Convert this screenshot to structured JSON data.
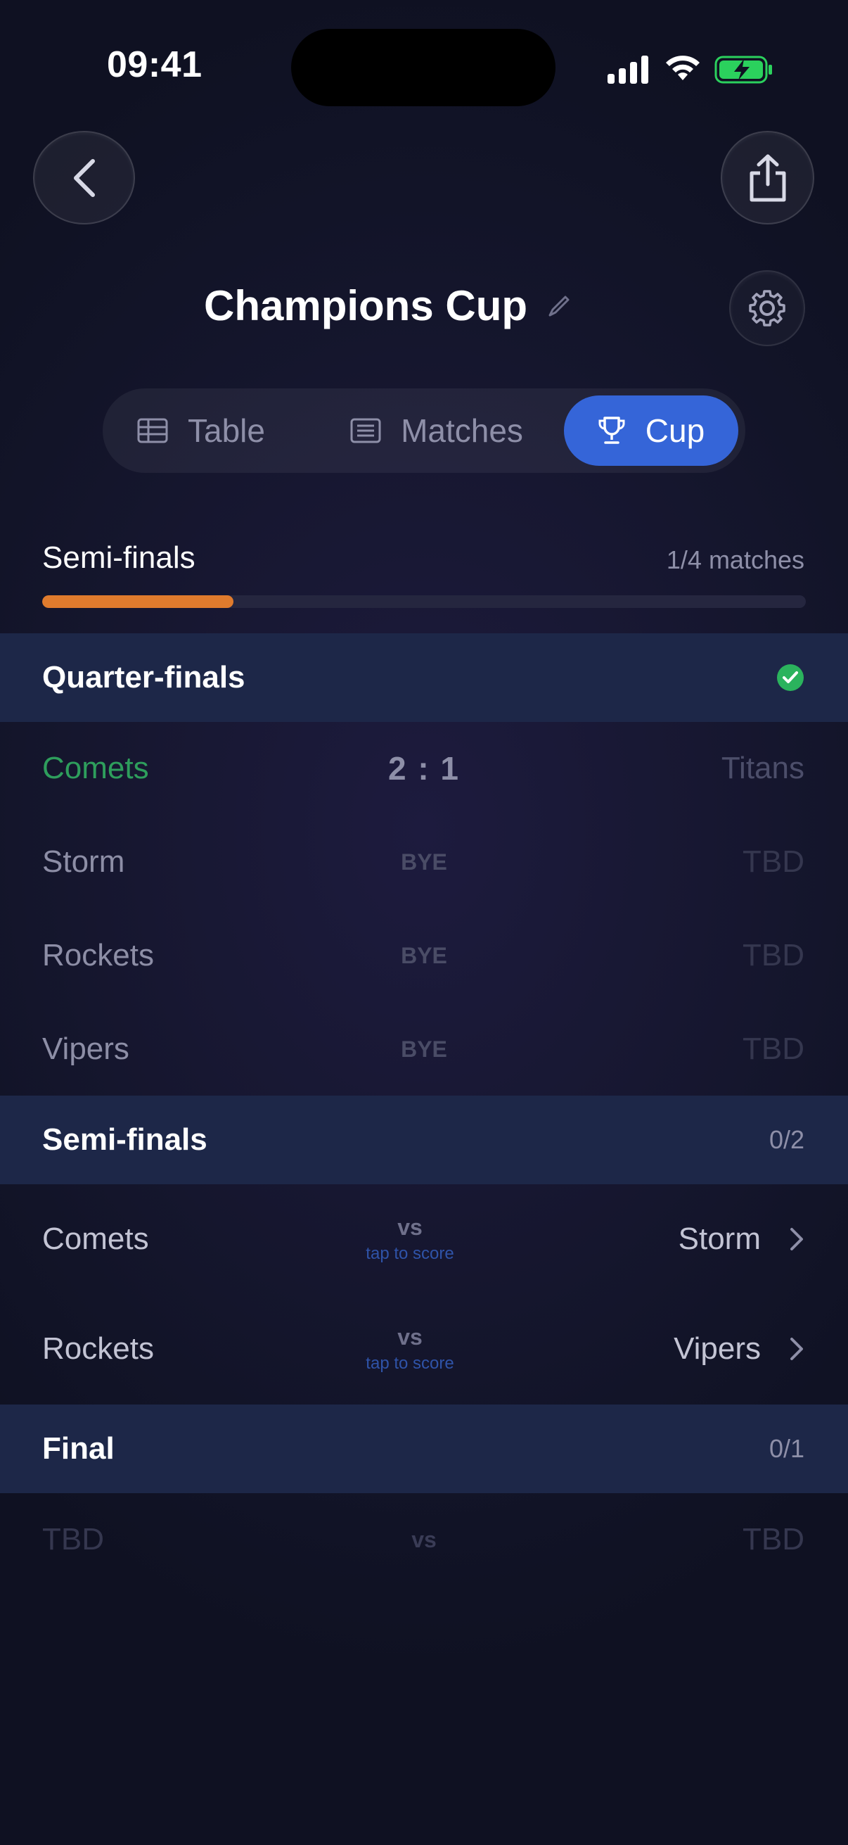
{
  "status_bar": {
    "time": "09:41"
  },
  "header": {
    "title": "Champions Cup",
    "tabs": [
      {
        "label": "Table",
        "icon": "table-icon",
        "active": false
      },
      {
        "label": "Matches",
        "icon": "list-icon",
        "active": false
      },
      {
        "label": "Cup",
        "icon": "trophy-icon",
        "active": true
      }
    ]
  },
  "progress": {
    "label": "Semi-finals",
    "count": "1/4 matches",
    "fraction": 0.25,
    "color": "#e07b2d"
  },
  "rounds": [
    {
      "name": "Quarter-finals",
      "status": "complete",
      "matches": [
        {
          "home": "Comets",
          "score": "2 : 1",
          "away": "Titans"
        },
        {
          "home": "Storm",
          "score": "BYE",
          "away": "TBD"
        },
        {
          "home": "Rockets",
          "score": "BYE",
          "away": "TBD"
        },
        {
          "home": "Vipers",
          "score": "BYE",
          "away": "TBD"
        }
      ]
    },
    {
      "name": "Semi-finals",
      "count": "0/2",
      "matches": [
        {
          "home": "Comets",
          "vs": "vs",
          "hint": "tap to score",
          "away": "Storm"
        },
        {
          "home": "Rockets",
          "vs": "vs",
          "hint": "tap to score",
          "away": "Vipers"
        }
      ]
    },
    {
      "name": "Final",
      "count": "0/1",
      "matches": [
        {
          "home": "TBD",
          "vs": "vs",
          "away": "TBD"
        }
      ]
    }
  ],
  "colors": {
    "accent": "#3565d8",
    "winner": "#2e9e5c",
    "complete_check": "#2bb35d"
  }
}
